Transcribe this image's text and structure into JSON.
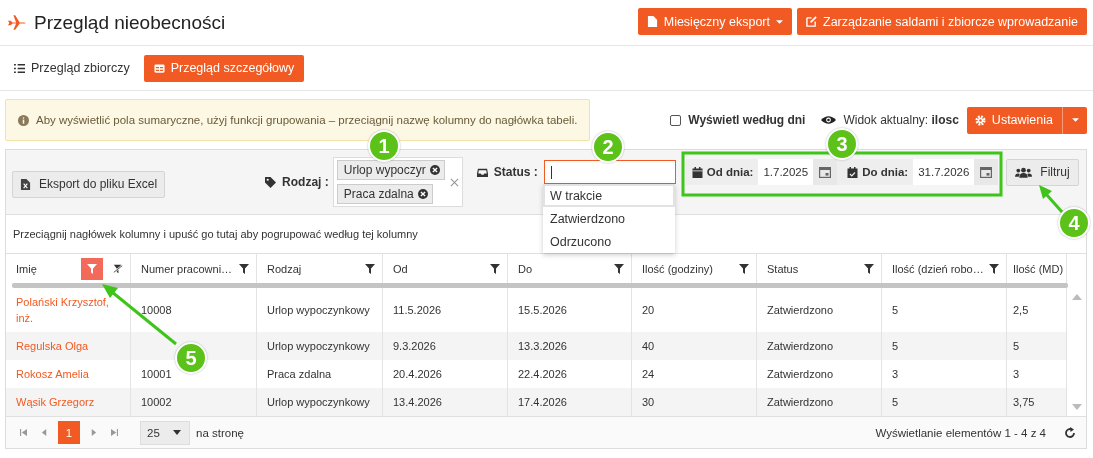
{
  "header": {
    "title": "Przegląd nieobecności",
    "buttons": [
      {
        "label": "Miesięczny eksport",
        "kind": "split"
      },
      {
        "label": "Zarządzanie saldami i zbiorcze wprowadzanie",
        "kind": "plain"
      }
    ]
  },
  "view_tabs": [
    {
      "label": "Przegląd zbiorczy",
      "selected": false
    },
    {
      "label": "Przegląd szczegółowy",
      "selected": true
    }
  ],
  "info_alert": "Aby wyświetlić pola sumaryczne, użyj funkcji grupowania – przeciągnij nazwę kolumny do nagłówka tabeli.",
  "show_by_days": {
    "label": "Wyświetl według dni",
    "checked": false
  },
  "current_view": "Widok aktualny: **ilosc**",
  "settings_button": {
    "label": "Ustawienia",
    "kind": "split"
  },
  "toolbar": {
    "export_button": "Eksport do pliku Excel",
    "type_filter": {
      "label": "Rodzaj :",
      "tags": [
        "Urlop wypoczyr",
        "Praca zdalna"
      ]
    },
    "status_filter": {
      "label": "Status :",
      "focused": true,
      "options": [
        {
          "label": "W trakcie",
          "selected": true
        },
        {
          "label": "Zatwierdzono",
          "selected": false
        },
        {
          "label": "Odrzucono",
          "selected": false
        }
      ]
    },
    "date_from": {
      "label": "Od dnia:",
      "value": "1.7.2025"
    },
    "date_to": {
      "label": "Do dnia:",
      "value": "31.7.2026"
    },
    "filter_button": "Filtruj"
  },
  "group_hint": "Przeciągnij nagłówek kolumny i upuść go tutaj aby pogrupować według tej kolumny",
  "table": {
    "columns": [
      {
        "label": "Imię",
        "filter_active": true
      },
      {
        "label": "Numer pracowni…",
        "filter_active": false
      },
      {
        "label": "Rodzaj",
        "filter_active": false
      },
      {
        "label": "Od",
        "filter_active": false
      },
      {
        "label": "Do",
        "filter_active": false
      },
      {
        "label": "Ilość (godziny)",
        "filter_active": false
      },
      {
        "label": "Status",
        "filter_active": false
      },
      {
        "label": "Ilość (dzień robo…",
        "filter_active": false
      },
      {
        "label": "Ilość (MD)"
      }
    ],
    "rows": [
      {
        "name": "Polański Krzysztof, inż.",
        "employee_no": "10008",
        "type": "Urlop wypoczynkowy",
        "from": "11.5.2026",
        "to": "15.5.2026",
        "hours": "20",
        "status": "Zatwierdzono",
        "workdays": "5",
        "md": "2,5"
      },
      {
        "name": "Regulska Olga",
        "type": "Urlop wypoczynkowy",
        "from": "9.3.2026",
        "to": "13.3.2026",
        "hours": "40",
        "status": "Zatwierdzono",
        "workdays": "5",
        "md": "5"
      },
      {
        "name": "Rokosz Amelia",
        "employee_no": "10001",
        "type": "Praca zdalna",
        "from": "20.4.2026",
        "to": "22.4.2026",
        "hours": "24",
        "status": "Zatwierdzono",
        "workdays": "3",
        "md": "3"
      },
      {
        "name": "Wąsik Grzegorz",
        "employee_no": "10002",
        "type": "Urlop wypoczynkowy",
        "from": "13.4.2026",
        "to": "17.4.2026",
        "hours": "30",
        "status": "Zatwierdzono",
        "workdays": "5",
        "md": "3,75"
      }
    ]
  },
  "pager": {
    "page": "1",
    "page_size": "25",
    "per_page_label": "na stronę",
    "summary": "Wyświetlanie elementów 1 - 4 z 4"
  },
  "callouts": [
    "1",
    "2",
    "3",
    "4",
    "5"
  ]
}
